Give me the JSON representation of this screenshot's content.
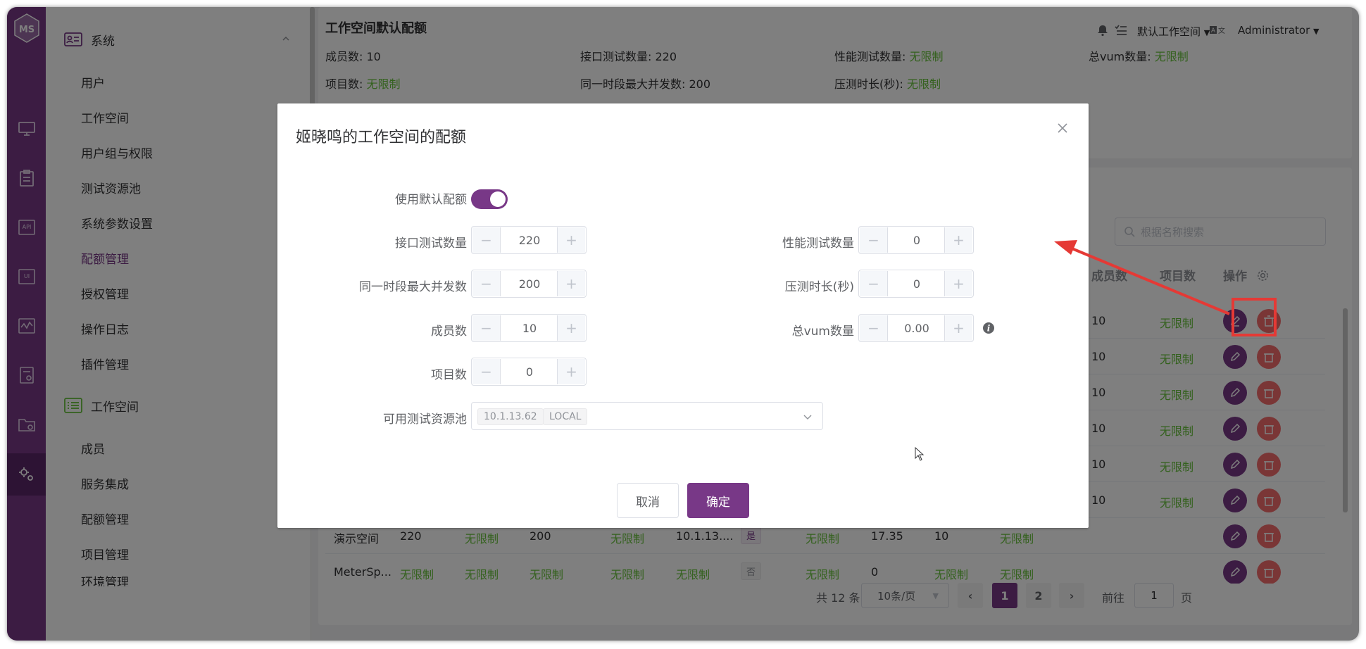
{
  "rail": {
    "logo": "ms-logo-icon",
    "items": [
      "monitor-icon",
      "clipboard-icon",
      "api-icon",
      "ui-icon",
      "performance-icon",
      "report-icon",
      "folder-icon",
      "settings-icon"
    ]
  },
  "menu": {
    "system_group": "系统",
    "system_items": [
      "用户",
      "工作空间",
      "用户组与权限",
      "测试资源池",
      "系统参数设置",
      "配额管理",
      "授权管理",
      "操作日志",
      "插件管理"
    ],
    "workspace_group": "工作空间",
    "workspace_items": [
      "成员",
      "服务集成",
      "配额管理",
      "项目管理",
      "环境管理"
    ]
  },
  "header": {
    "workspace_label": "默认工作空间",
    "lang_icon": "translate-icon",
    "user": "Administrator"
  },
  "quota_card": {
    "title": "工作空间默认配额",
    "items": [
      {
        "label": "成员数: ",
        "value": "10",
        "green": false
      },
      {
        "label": "接口测试数量: ",
        "value": "220",
        "green": false
      },
      {
        "label": "性能测试数量: ",
        "value": "无限制",
        "green": true
      },
      {
        "label": "总vum数量: ",
        "value": "无限制",
        "green": true
      },
      {
        "label": "项目数: ",
        "value": "无限制",
        "green": true
      },
      {
        "label": "同一时段最大并发数: ",
        "value": "200",
        "green": false
      },
      {
        "label": "压测时长(秒): ",
        "value": "无限制",
        "green": true
      }
    ]
  },
  "list": {
    "search_placeholder": "根据名称搜索",
    "headers": {
      "members": "成员数",
      "projects": "项目数",
      "ops": "操作"
    },
    "rows_partial": [
      {
        "members": "10",
        "projects": "无限制"
      },
      {
        "members": "10",
        "projects": "无限制"
      },
      {
        "members": "10",
        "projects": "无限制"
      },
      {
        "members": "10",
        "projects": "无限制"
      },
      {
        "members": "10",
        "projects": "无限制"
      },
      {
        "members": "10",
        "projects": "无限制"
      }
    ],
    "rows_full": [
      {
        "name": "演示空间",
        "api": "220",
        "perf": "无限制",
        "conc": "200",
        "dur": "无限制",
        "pool": "10.1.13....",
        "default": "是",
        "vum": "无限制",
        "used": "17.35",
        "members": "10",
        "projects": "无限制"
      },
      {
        "name": "MeterSp...",
        "api": "无限制",
        "perf": "无限制",
        "conc": "无限制",
        "dur": "无限制",
        "pool": "无限制",
        "default": "否",
        "vum": "无限制",
        "used": "0",
        "members": "无限制",
        "projects": "无限制"
      }
    ]
  },
  "pagination": {
    "total": "共 12 条",
    "page_size": "10条/页",
    "pages": [
      "1",
      "2"
    ],
    "goto_label": "前往",
    "goto_value": "1",
    "page_unit": "页"
  },
  "dialog": {
    "title": "姬晓鸣的工作空间的配额",
    "use_default_label": "使用默认配额",
    "use_default_on": true,
    "fields": {
      "api_label": "接口测试数量",
      "api_value": "220",
      "perf_label": "性能测试数量",
      "perf_value": "0",
      "conc_label": "同一时段最大并发数",
      "conc_value": "200",
      "dur_label": "压测时长(秒)",
      "dur_value": "0",
      "members_label": "成员数",
      "members_value": "10",
      "vum_label": "总vum数量",
      "vum_value": "0.00",
      "projects_label": "项目数",
      "projects_value": "0",
      "pool_label": "可用测试资源池",
      "pool_tags": [
        "10.1.13.62",
        "LOCAL"
      ]
    },
    "cancel": "取消",
    "confirm": "确定"
  },
  "colors": {
    "brand": "#783887",
    "green": "#67c23a",
    "danger": "#f56c6c",
    "annotation": "#e53935"
  }
}
